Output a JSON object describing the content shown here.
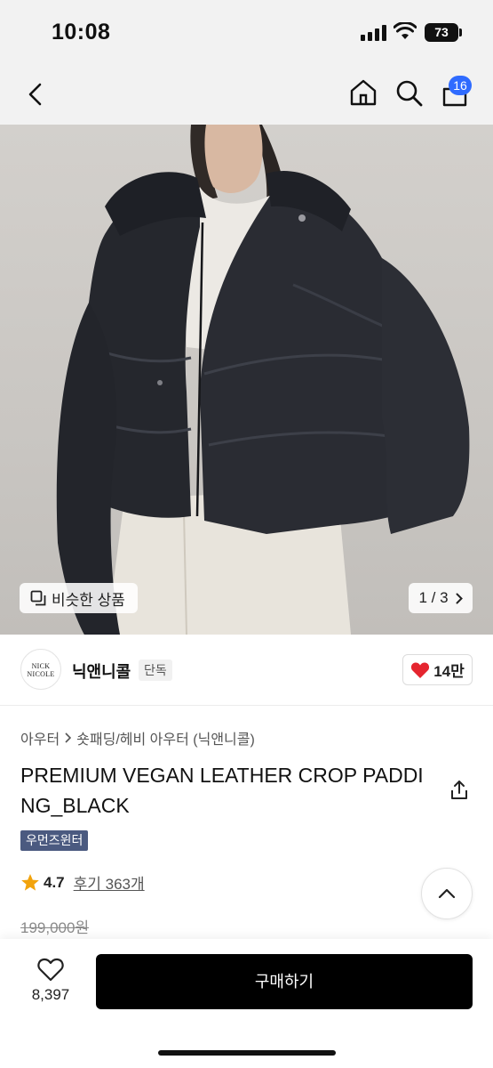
{
  "status_bar": {
    "time": "10:08",
    "battery": "73"
  },
  "nav": {
    "cart_count": "16",
    "icons": [
      "back-chevron-icon",
      "home-icon",
      "search-icon",
      "cart-icon"
    ]
  },
  "hero": {
    "similar_label": "비슷한 상품",
    "pager": "1 / 3"
  },
  "brand": {
    "logo_text": "NICK NICOLE",
    "name": "닉앤니콜",
    "tag": "단독",
    "likes": "14만"
  },
  "product": {
    "breadcrumb": [
      "아우터",
      "숏패딩/헤비 아우터 (닉앤니콜)"
    ],
    "title": "PREMIUM VEGAN LEATHER CROP PADDING_BLACK",
    "promo_tag": "우먼즈윈터",
    "rating": "4.7",
    "reviews": "후기 363개",
    "original_price": "199,000원"
  },
  "bottom": {
    "wish_count": "8,397",
    "buy_label": "구매하기"
  },
  "colors": {
    "accent_blue": "#2f6bff",
    "heart_red": "#e5252f",
    "star": "#f2a30c",
    "promo_bg": "#4b5a80",
    "buy_bg": "#000000"
  }
}
